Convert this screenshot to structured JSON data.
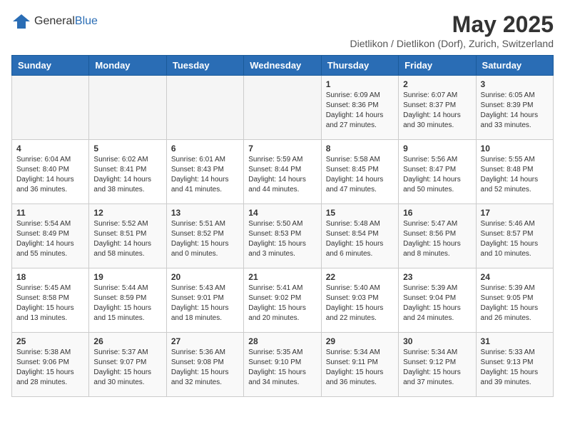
{
  "header": {
    "logo_general": "General",
    "logo_blue": "Blue",
    "month_title": "May 2025",
    "location": "Dietlikon / Dietlikon (Dorf), Zurich, Switzerland"
  },
  "days_of_week": [
    "Sunday",
    "Monday",
    "Tuesday",
    "Wednesday",
    "Thursday",
    "Friday",
    "Saturday"
  ],
  "weeks": [
    [
      {
        "day": "",
        "info": ""
      },
      {
        "day": "",
        "info": ""
      },
      {
        "day": "",
        "info": ""
      },
      {
        "day": "",
        "info": ""
      },
      {
        "day": "1",
        "info": "Sunrise: 6:09 AM\nSunset: 8:36 PM\nDaylight: 14 hours and 27 minutes."
      },
      {
        "day": "2",
        "info": "Sunrise: 6:07 AM\nSunset: 8:37 PM\nDaylight: 14 hours and 30 minutes."
      },
      {
        "day": "3",
        "info": "Sunrise: 6:05 AM\nSunset: 8:39 PM\nDaylight: 14 hours and 33 minutes."
      }
    ],
    [
      {
        "day": "4",
        "info": "Sunrise: 6:04 AM\nSunset: 8:40 PM\nDaylight: 14 hours and 36 minutes."
      },
      {
        "day": "5",
        "info": "Sunrise: 6:02 AM\nSunset: 8:41 PM\nDaylight: 14 hours and 38 minutes."
      },
      {
        "day": "6",
        "info": "Sunrise: 6:01 AM\nSunset: 8:43 PM\nDaylight: 14 hours and 41 minutes."
      },
      {
        "day": "7",
        "info": "Sunrise: 5:59 AM\nSunset: 8:44 PM\nDaylight: 14 hours and 44 minutes."
      },
      {
        "day": "8",
        "info": "Sunrise: 5:58 AM\nSunset: 8:45 PM\nDaylight: 14 hours and 47 minutes."
      },
      {
        "day": "9",
        "info": "Sunrise: 5:56 AM\nSunset: 8:47 PM\nDaylight: 14 hours and 50 minutes."
      },
      {
        "day": "10",
        "info": "Sunrise: 5:55 AM\nSunset: 8:48 PM\nDaylight: 14 hours and 52 minutes."
      }
    ],
    [
      {
        "day": "11",
        "info": "Sunrise: 5:54 AM\nSunset: 8:49 PM\nDaylight: 14 hours and 55 minutes."
      },
      {
        "day": "12",
        "info": "Sunrise: 5:52 AM\nSunset: 8:51 PM\nDaylight: 14 hours and 58 minutes."
      },
      {
        "day": "13",
        "info": "Sunrise: 5:51 AM\nSunset: 8:52 PM\nDaylight: 15 hours and 0 minutes."
      },
      {
        "day": "14",
        "info": "Sunrise: 5:50 AM\nSunset: 8:53 PM\nDaylight: 15 hours and 3 minutes."
      },
      {
        "day": "15",
        "info": "Sunrise: 5:48 AM\nSunset: 8:54 PM\nDaylight: 15 hours and 6 minutes."
      },
      {
        "day": "16",
        "info": "Sunrise: 5:47 AM\nSunset: 8:56 PM\nDaylight: 15 hours and 8 minutes."
      },
      {
        "day": "17",
        "info": "Sunrise: 5:46 AM\nSunset: 8:57 PM\nDaylight: 15 hours and 10 minutes."
      }
    ],
    [
      {
        "day": "18",
        "info": "Sunrise: 5:45 AM\nSunset: 8:58 PM\nDaylight: 15 hours and 13 minutes."
      },
      {
        "day": "19",
        "info": "Sunrise: 5:44 AM\nSunset: 8:59 PM\nDaylight: 15 hours and 15 minutes."
      },
      {
        "day": "20",
        "info": "Sunrise: 5:43 AM\nSunset: 9:01 PM\nDaylight: 15 hours and 18 minutes."
      },
      {
        "day": "21",
        "info": "Sunrise: 5:41 AM\nSunset: 9:02 PM\nDaylight: 15 hours and 20 minutes."
      },
      {
        "day": "22",
        "info": "Sunrise: 5:40 AM\nSunset: 9:03 PM\nDaylight: 15 hours and 22 minutes."
      },
      {
        "day": "23",
        "info": "Sunrise: 5:39 AM\nSunset: 9:04 PM\nDaylight: 15 hours and 24 minutes."
      },
      {
        "day": "24",
        "info": "Sunrise: 5:39 AM\nSunset: 9:05 PM\nDaylight: 15 hours and 26 minutes."
      }
    ],
    [
      {
        "day": "25",
        "info": "Sunrise: 5:38 AM\nSunset: 9:06 PM\nDaylight: 15 hours and 28 minutes."
      },
      {
        "day": "26",
        "info": "Sunrise: 5:37 AM\nSunset: 9:07 PM\nDaylight: 15 hours and 30 minutes."
      },
      {
        "day": "27",
        "info": "Sunrise: 5:36 AM\nSunset: 9:08 PM\nDaylight: 15 hours and 32 minutes."
      },
      {
        "day": "28",
        "info": "Sunrise: 5:35 AM\nSunset: 9:10 PM\nDaylight: 15 hours and 34 minutes."
      },
      {
        "day": "29",
        "info": "Sunrise: 5:34 AM\nSunset: 9:11 PM\nDaylight: 15 hours and 36 minutes."
      },
      {
        "day": "30",
        "info": "Sunrise: 5:34 AM\nSunset: 9:12 PM\nDaylight: 15 hours and 37 minutes."
      },
      {
        "day": "31",
        "info": "Sunrise: 5:33 AM\nSunset: 9:13 PM\nDaylight: 15 hours and 39 minutes."
      }
    ]
  ]
}
